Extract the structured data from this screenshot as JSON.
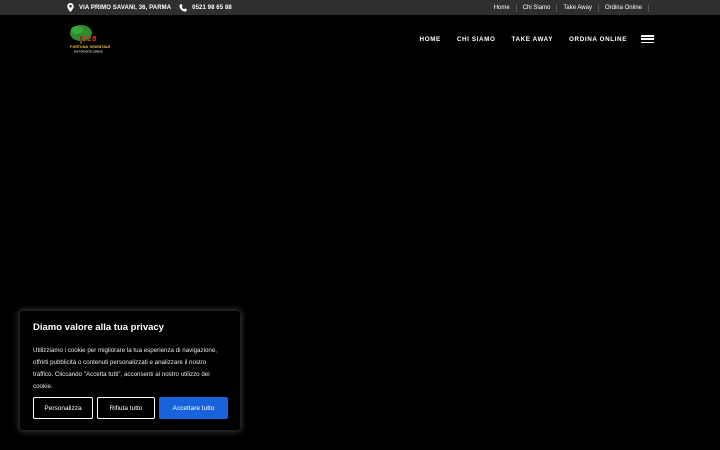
{
  "topbar": {
    "address": "VIA PRIMO SAVANI, 36, PARMA",
    "phone": "0521 98 65 88",
    "links": [
      "Home",
      "Chi Siamo",
      "Take Away",
      "Ordina Online"
    ]
  },
  "logo": {
    "brand_number": "128",
    "brand_name": "FORTUNA ORIENTALE",
    "tagline": "RISTORANTE CINESE"
  },
  "nav": {
    "items": [
      "HOME",
      "CHI SIAMO",
      "TAKE AWAY",
      "ORDINA ONLINE"
    ]
  },
  "cookie_banner": {
    "title": "Diamo valore alla tua privacy",
    "body": "Utilizziamo i cookie per migliorare la tua esperienza di navigazione, offrirti pubblicità o contenuti personalizzati e analizzare il nostro traffico. Cliccando \"Accetta tutti\", acconsenti al nostro utilizzo dei cookie.",
    "customize_label": "Personalizza",
    "reject_label": "Rifiuta tutto",
    "accept_label": "Accettare tutto"
  },
  "colors": {
    "topbar_bg": "#2f2f2f",
    "accept_button": "#1863dc",
    "logo_green": "#2e8b2e",
    "logo_red": "#d12a1e"
  }
}
